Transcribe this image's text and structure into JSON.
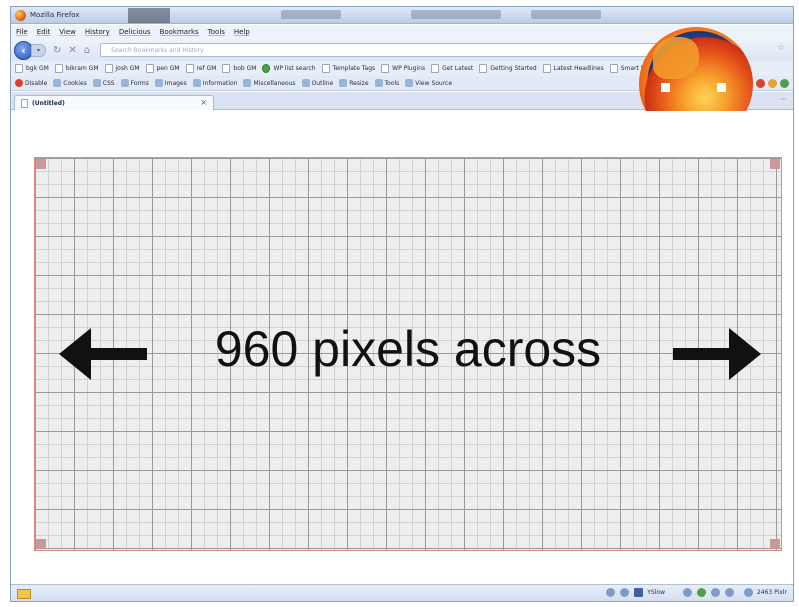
{
  "window": {
    "title": "Mozilla Firefox"
  },
  "menu": [
    "File",
    "Edit",
    "View",
    "History",
    "Delicious",
    "Bookmarks",
    "Tools",
    "Help"
  ],
  "navbar": {
    "url_placeholder": "Search Bookmarks and History"
  },
  "bookmarks": [
    "bgk GM",
    "bikram GM",
    "josh GM",
    "pen GM",
    "ref GM",
    "bob GM",
    "WP list search",
    "Template Tags",
    "WP Plugins",
    "Get Latest",
    "Getting Started",
    "Latest Headlines",
    "Smart Ratings"
  ],
  "devbar": [
    "Disable",
    "Cookies",
    "CSS",
    "Forms",
    "Images",
    "Information",
    "Miscellaneous",
    "Outline",
    "Resize",
    "Tools",
    "View Source"
  ],
  "tab": {
    "title": "(Untitled)"
  },
  "content": {
    "headline": "960 pixels across"
  },
  "status": {
    "yslow": "YSlow",
    "zoom": "2463 Pixlr"
  },
  "colors": {
    "grid_border": "#e08a8a",
    "grid_major": "#9a9a9a",
    "grid_minor": "#d2d2d2",
    "chrome": "#dbe5f3"
  }
}
